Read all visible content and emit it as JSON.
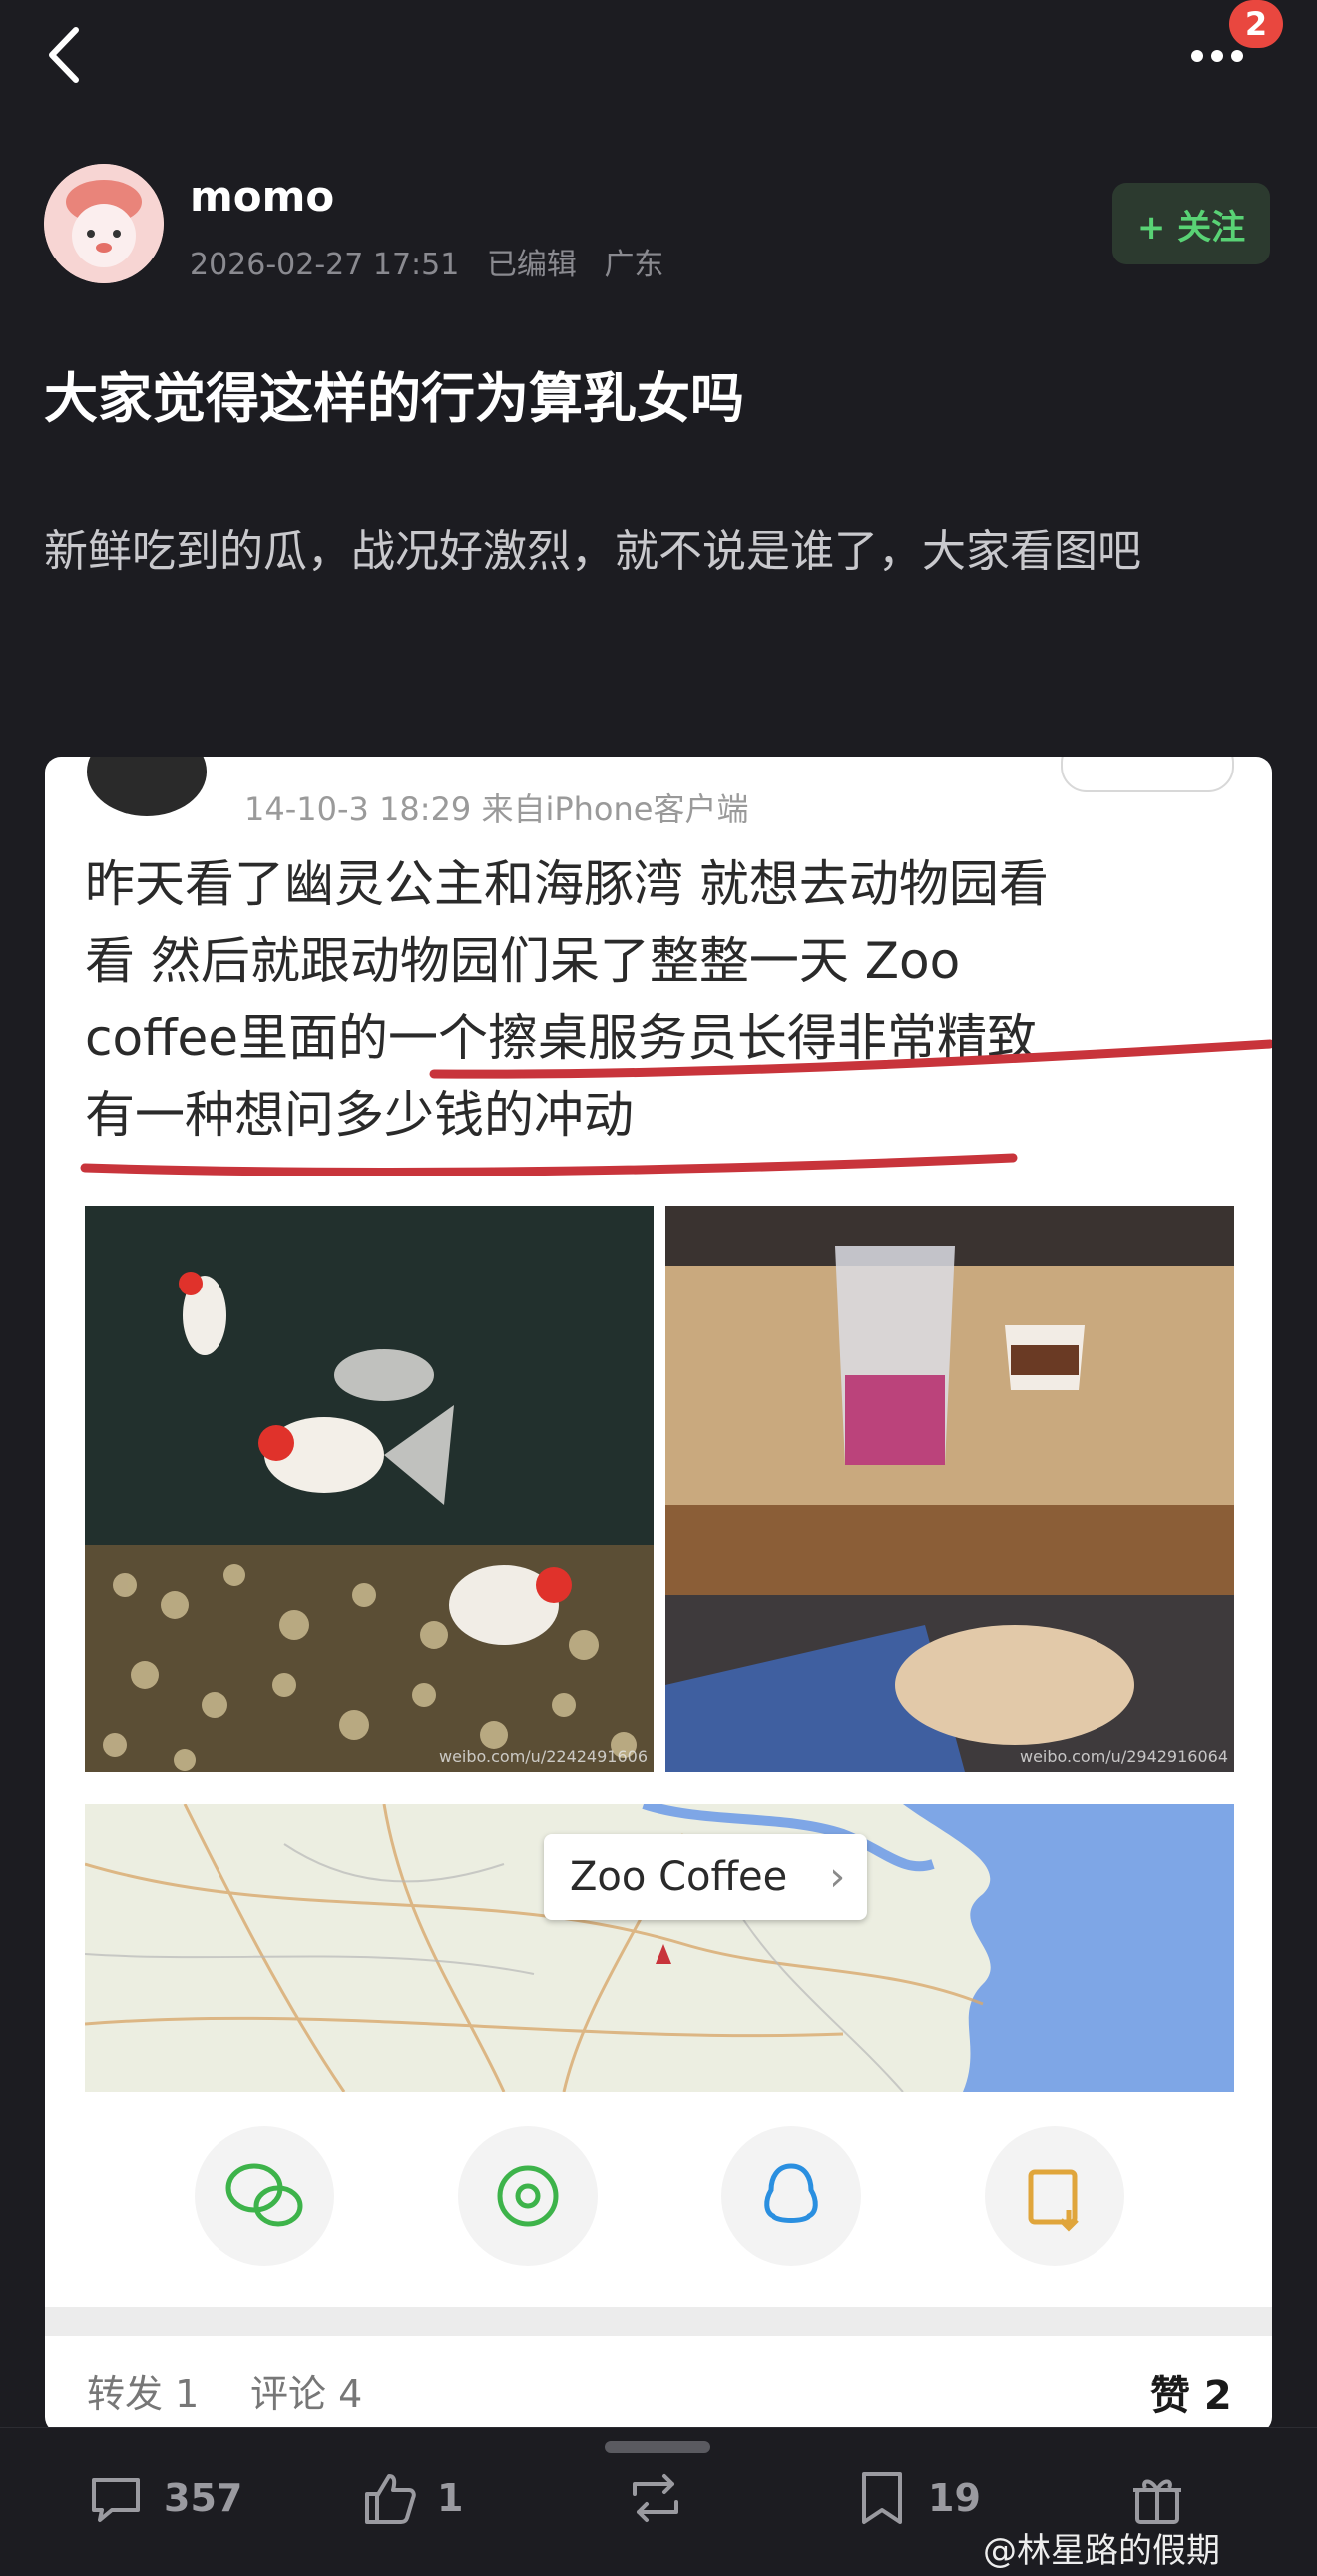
{
  "notification_badge": "2",
  "author": {
    "name": "momo",
    "date": "2026-02-27 17:51",
    "edited": "已编辑",
    "location": "广东"
  },
  "follow_label": "+ 关注",
  "post": {
    "title": "大家觉得这样的行为算乳女吗",
    "body": "新鲜吃到的瓜，战况好激烈，就不说是谁了，大家看图吧"
  },
  "screenshot": {
    "meta": "14-10-3 18:29  来自iPhone客户端",
    "lines": [
      "昨天看了幽灵公主和海豚湾  就想去动物园看",
      "看  然后就跟动物园们呆了整整一天 Zoo",
      "coffee里面的一个擦桌服务员长得非常精致",
      "有一种想问多少钱的冲动"
    ],
    "watermark_left": "weibo.com/u/2242491606",
    "watermark_right": "weibo.com/u/2942916064",
    "map_place": "Zoo Coffee",
    "reposts": "转发 1",
    "comments": "评论 4",
    "likes": "赞 2"
  },
  "bottom_bar": {
    "comments_count": "357",
    "likes_count": "1",
    "collect_count": "19"
  },
  "source_watermark": "@林星路的假期",
  "colors": {
    "background": "#1c1c21",
    "follow_text": "#59d275",
    "follow_bg": "#2c3a2f",
    "badge": "#e9473f",
    "underline": "#c8343b"
  }
}
